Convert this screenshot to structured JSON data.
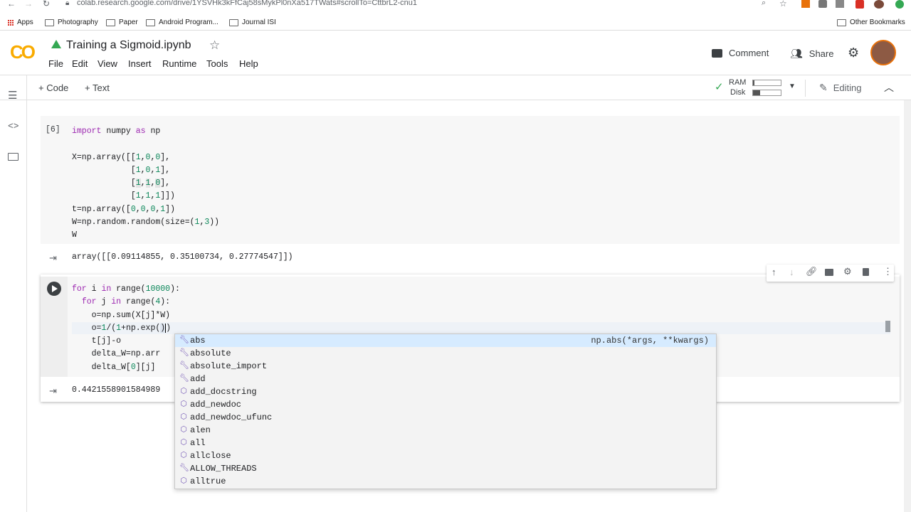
{
  "browser": {
    "url": "colab.research.google.com/drive/1YSVHk3kFfCaj58sMykPl0nXa517TWats#scrollTo=CttbrL2-cnu1",
    "bookmarks": [
      "Apps",
      "Photography",
      "Paper",
      "Android Program...",
      "Journal ISI"
    ],
    "other_bookmarks": "Other Bookmarks"
  },
  "header": {
    "logo": "CO",
    "title": "Training a Sigmoid.ipynb",
    "menu": [
      "File",
      "Edit",
      "View",
      "Insert",
      "Runtime",
      "Tools",
      "Help"
    ],
    "comment": "Comment",
    "share": "Share"
  },
  "toolbar": {
    "add_code": "+ Code",
    "add_text": "+ Text",
    "ram_label": "RAM",
    "disk_label": "Disk",
    "editing": "Editing"
  },
  "cell1": {
    "exec_count": "[6]",
    "lines": [
      "import numpy as np",
      "",
      "X=np.array([[1,0,0],",
      "            [1,0,1],",
      "            [1,1,0],",
      "            [1,1,1]])",
      "t=np.array([0,0,0,1])",
      "W=np.random.random(size=(1,3))",
      "W"
    ],
    "output": "array([[0.09114855, 0.35100734, 0.27774547]])"
  },
  "cell2": {
    "lines": [
      "for i in range(10000):",
      "  for j in range(4):",
      "    o=np.sum(X[j]*W)",
      "    o=1/(1+np.exp())",
      "    t[j]-o",
      "    delta_W=np.arr",
      "    delta_W[0][j]"
    ],
    "output": "0.4421558901584989"
  },
  "autocomplete": {
    "items": [
      {
        "label": "abs",
        "icon": "wrench-icon",
        "detail": "np.abs(*args, **kwargs)"
      },
      {
        "label": "absolute",
        "icon": "wrench-icon",
        "detail": ""
      },
      {
        "label": "absolute_import",
        "icon": "wrench-icon",
        "detail": ""
      },
      {
        "label": "add",
        "icon": "wrench-icon",
        "detail": ""
      },
      {
        "label": "add_docstring",
        "icon": "cube-icon",
        "detail": ""
      },
      {
        "label": "add_newdoc",
        "icon": "cube-icon",
        "detail": ""
      },
      {
        "label": "add_newdoc_ufunc",
        "icon": "cube-icon",
        "detail": ""
      },
      {
        "label": "alen",
        "icon": "cube-icon",
        "detail": ""
      },
      {
        "label": "all",
        "icon": "cube-icon",
        "detail": ""
      },
      {
        "label": "allclose",
        "icon": "cube-icon",
        "detail": ""
      },
      {
        "label": "ALLOW_THREADS",
        "icon": "wrench-icon",
        "detail": ""
      },
      {
        "label": "alltrue",
        "icon": "cube-icon",
        "detail": ""
      }
    ]
  },
  "colors": {
    "accent": "#f9ab00",
    "selection": "#d6ebff",
    "keyword": "#9c27b0",
    "number": "#098658"
  }
}
